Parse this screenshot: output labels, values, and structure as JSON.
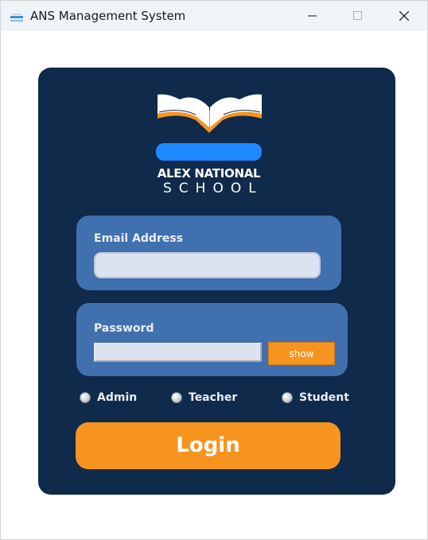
{
  "window": {
    "title": "ANS Management System",
    "icon": "app-icon"
  },
  "logo": {
    "line1": "ALEX NATIONAL",
    "line2": "SCHOOL",
    "colors": {
      "book_white": "#ffffff",
      "accent_orange": "#f7941f",
      "accent_blue": "#1e88ff"
    }
  },
  "login_form": {
    "email": {
      "label": "Email Address",
      "value": "",
      "placeholder": ""
    },
    "password": {
      "label": "Password",
      "value": "",
      "placeholder": "",
      "show_button_label": "show"
    },
    "roles": [
      {
        "label": "Admin",
        "selected": false
      },
      {
        "label": "Teacher",
        "selected": false
      },
      {
        "label": "Student",
        "selected": false
      }
    ],
    "login_button_label": "Login"
  },
  "colors": {
    "card_background": "#0f2a4a",
    "panel_background": "#4170ae",
    "accent": "#f7941f"
  }
}
